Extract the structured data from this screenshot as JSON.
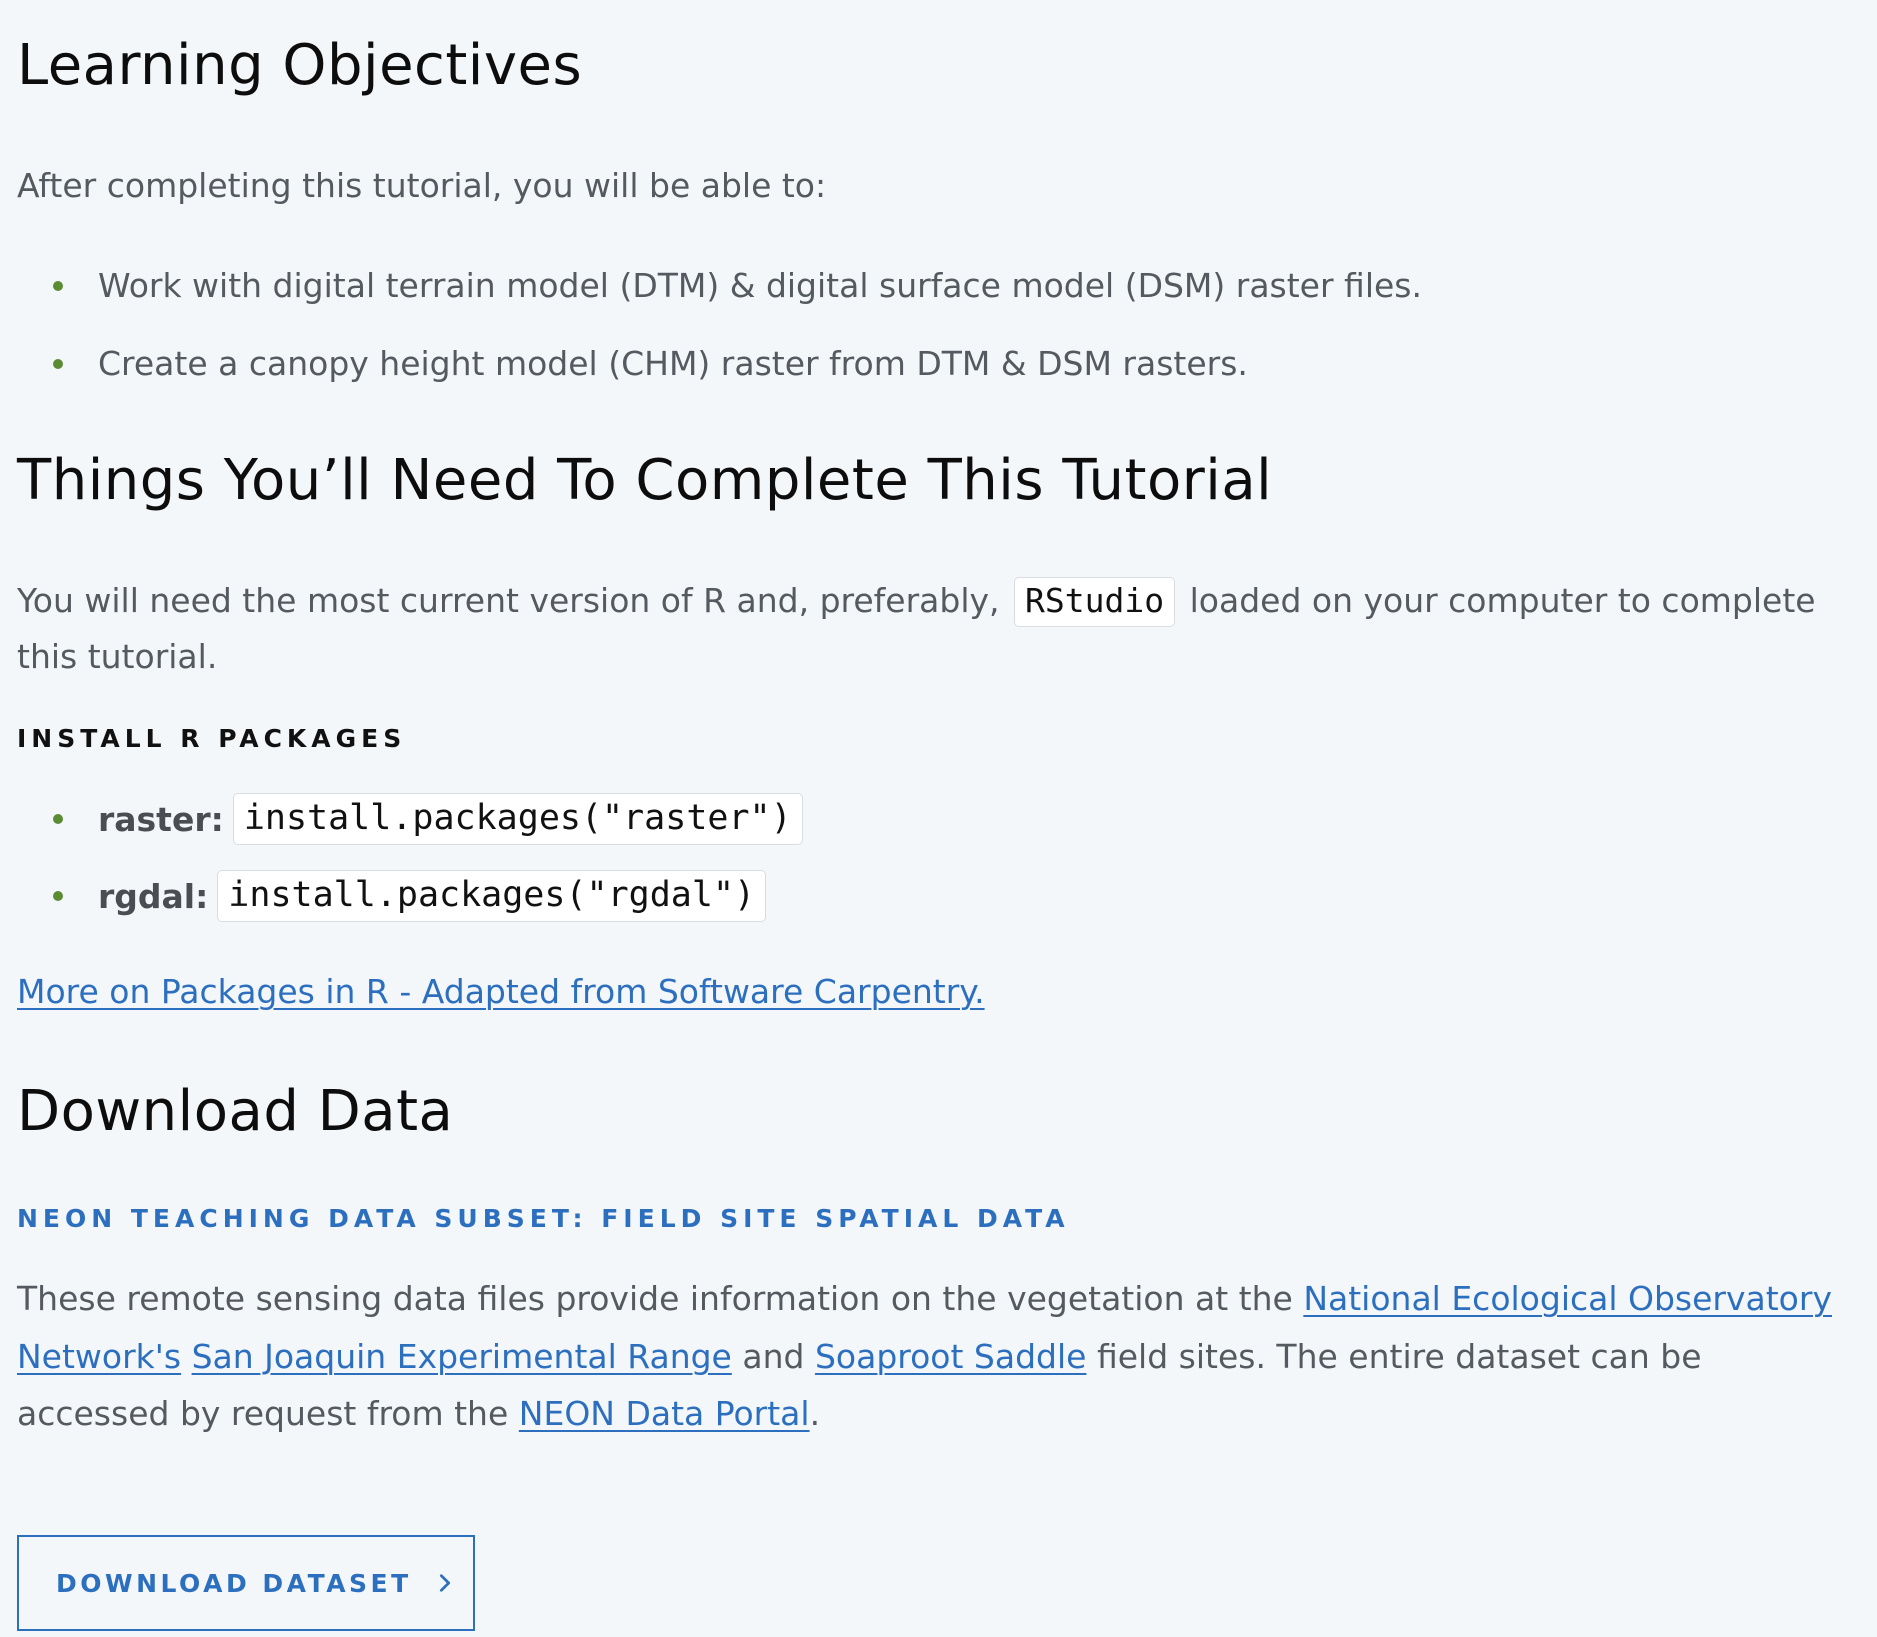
{
  "sections": {
    "objectives": {
      "title": "Learning Objectives",
      "intro": "After completing this tutorial, you will be able to:",
      "items": [
        "Work with digital terrain model (DTM) & digital surface model (DSM) raster files.",
        "Create a canopy height model (CHM) raster from DTM & DSM rasters."
      ]
    },
    "requirements": {
      "title": "Things You’ll Need To Complete This Tutorial",
      "text_before": "You will need the most current version of R and, preferably,",
      "code": "RStudio",
      "text_after_line1": "loaded on your computer to complete",
      "text_after_line2": "this tutorial.",
      "install_heading": "Install R Packages",
      "packages": [
        {
          "name": "raster:",
          "command": "install.packages(\"raster\")"
        },
        {
          "name": "rgdal:",
          "command": "install.packages(\"rgdal\")"
        }
      ],
      "more_link": "More on Packages in R - Adapted from Software Carpentry."
    },
    "download": {
      "title": "Download Data",
      "subset_heading": "NEON Teaching Data Subset: Field Site Spatial Data",
      "text_1": "These remote sensing data files provide information on the vegetation at the",
      "link_neon": "National Ecological Observatory Network's",
      "link_sjer": "San Joaquin Experimental Range",
      "text_and": "and",
      "link_soap": "Soaproot Saddle",
      "text_2": "field sites. The entire dataset can be accessed by request from the",
      "link_portal": "NEON Data Portal",
      "text_end": ".",
      "button_label": "Download Dataset"
    }
  },
  "colors": {
    "background": "#f4f7fa",
    "link": "#2d6fbf",
    "bullet": "#5b8c34",
    "heading": "#0d0d0d"
  },
  "icons": {
    "button_icon": "chevron-right-icon"
  }
}
